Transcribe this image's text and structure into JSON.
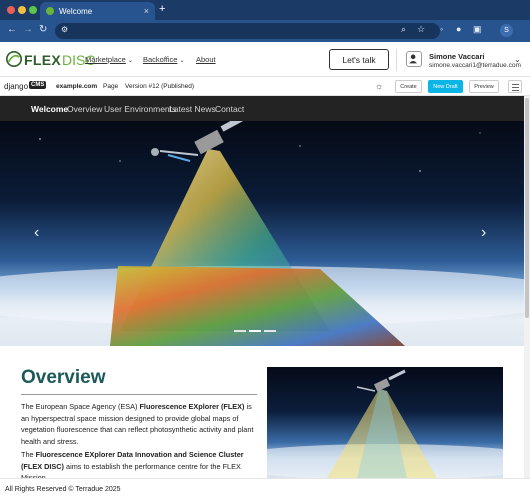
{
  "browser": {
    "tab_title": "Welcome",
    "tab_close": "×",
    "new_tab": "+",
    "profile_initial": "S",
    "traffic_colors": [
      "#ec5f57",
      "#f4bd3f",
      "#5bc74a"
    ]
  },
  "site": {
    "logo_flex": "FLEX",
    "logo_disc": "DISC",
    "menu": [
      "Marketplace",
      "Backoffice",
      "About"
    ],
    "talk_button": "Let's talk",
    "user_name": "Simone Vaccari",
    "user_email": "simone.vaccari1@terradue.com"
  },
  "cms": {
    "django": "django",
    "badge": "CMS",
    "site": "example.com",
    "page": "Page",
    "version": "Version #12 (Published)",
    "create": "Create",
    "new_draft": "New Draft",
    "preview": "Preview"
  },
  "nav": [
    "Welcome",
    "Overview",
    "User Environments",
    "Latest News",
    "Contact"
  ],
  "hero": {
    "prev": "‹",
    "next": "›"
  },
  "overview": {
    "title": "Overview",
    "p1_a": "The European Space Agency (ESA) ",
    "p1_b": "Fluorescence EXplorer (FLEX)",
    "p1_c": " is an hyperspectral space mission designed to provide global maps of vegetation fluorescence that can reflect photosynthetic activity and plant health and stress.",
    "p2_a": "The ",
    "p2_b": "Fluorescence EXplorer Data Innovation and Science Cluster (FLEX DISC)",
    "p2_c": " aims to establish the performance centre for the FLEX Mission."
  },
  "footer": {
    "text": "All Rights Reserved © Terradue 2025"
  },
  "colors": {
    "accent_teal": "#1c5a5a",
    "logo_green": "#2e5d2a",
    "logo_light_green": "#6bb33b",
    "cms_primary": "#0bb5e5",
    "nav_bg": "#232323"
  }
}
